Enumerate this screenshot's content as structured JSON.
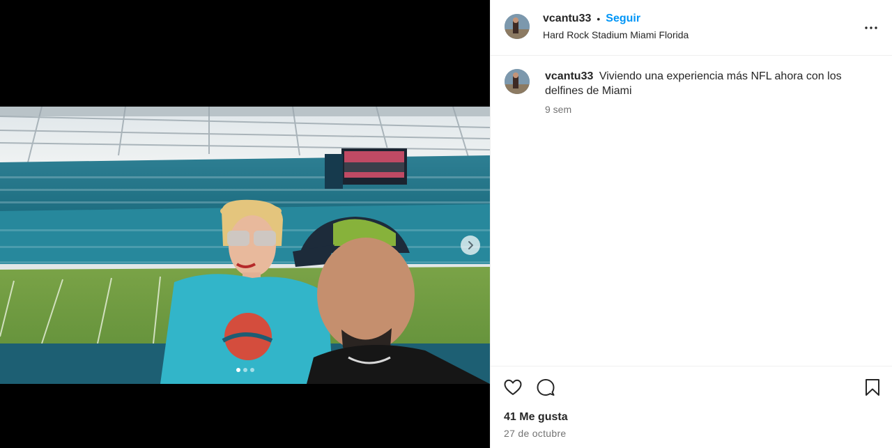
{
  "post": {
    "username": "vcantu33",
    "separator": "•",
    "follow_label": "Seguir",
    "location": "Hard Rock Stadium Miami Florida",
    "caption_user": "vcantu33",
    "caption_text": "Viviendo una experiencia más NFL ahora con los delfines de Miami",
    "relative_time": "9 sem",
    "likes_text": "41 Me gusta",
    "date_text": "27 de octubre"
  },
  "media": {
    "carousel_count": 3,
    "carousel_active_index": 0,
    "next_icon": "chevron-right-icon"
  },
  "icons": {
    "more": "more-horizontal-icon",
    "like": "heart-icon",
    "comment": "comment-icon",
    "save": "bookmark-icon"
  },
  "colors": {
    "follow_blue": "#0095f6",
    "text_primary": "#262626",
    "text_secondary": "#737373",
    "divider": "#efefef",
    "dolphins_aqua": "#2fb3c6"
  }
}
